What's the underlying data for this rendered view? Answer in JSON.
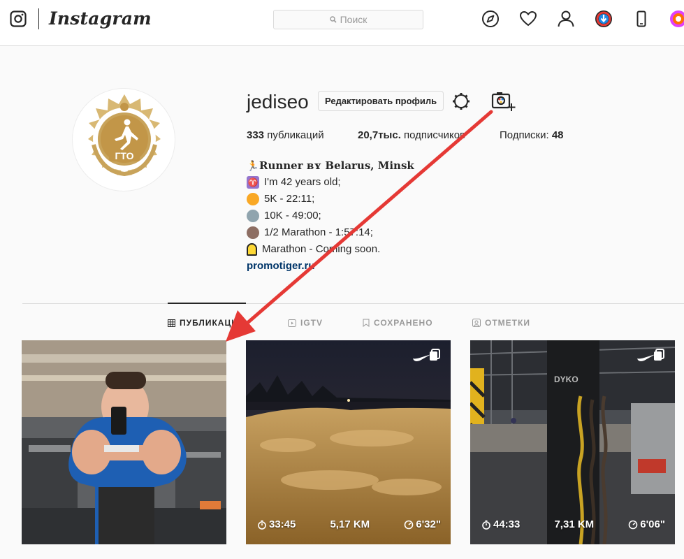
{
  "nav": {
    "brand": "Instagram",
    "search_placeholder": "Поиск"
  },
  "profile": {
    "username": "jediseo",
    "edit_label": "Редактировать профиль",
    "avatar_text": "ГТО",
    "stats": {
      "posts_count": "333",
      "posts_label": "публикаций",
      "followers_count": "20,7тыс.",
      "followers_label": "подписчиков",
      "following_label": "Подписки:",
      "following_count": "48"
    },
    "bio": {
      "name": "𝐑𝐮𝐧𝐧𝐞𝐫 ʙʏ 𝐁𝐞𝐥𝐚𝐫𝐮𝐬, 𝐌𝐢𝐧𝐬𝐤",
      "line1": "I'm 42 years old;",
      "line2": "5K - 22:11;",
      "line3": "10K - 49:00;",
      "line4": "1/2 Marathon - 1:57:14;",
      "line5": "Marathon - Coming soon.",
      "link": "promotiger.ru"
    }
  },
  "tabs": {
    "posts": "ПУБЛИКАЦИИ",
    "igtv": "IGTV",
    "saved": "СОХРАНЕНО",
    "tagged": "ОТМЕТКИ"
  },
  "posts": [
    {
      "type": "photo"
    },
    {
      "type": "run",
      "time": "33:45",
      "distance": "5,17 KM",
      "pace": "6'32\""
    },
    {
      "type": "run",
      "time": "44:33",
      "distance": "7,31 KM",
      "pace": "6'06\""
    }
  ],
  "colors": {
    "accent_link": "#003569",
    "arrow": "#e53935",
    "border": "#dbdbdb"
  }
}
